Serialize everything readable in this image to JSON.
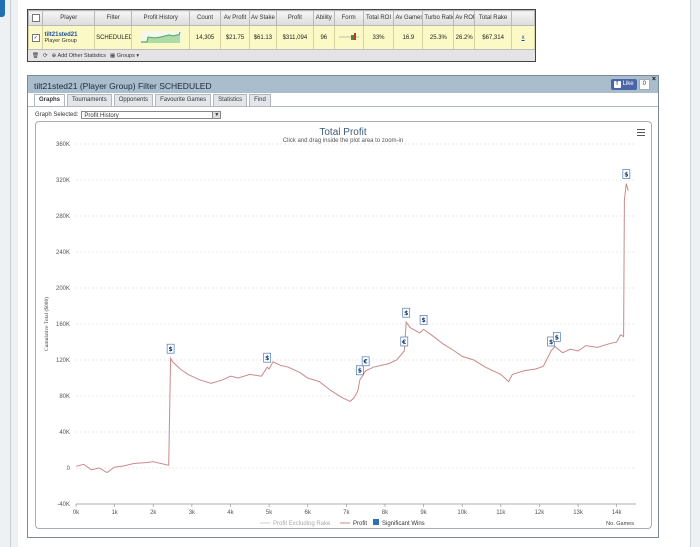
{
  "top_table": {
    "headers": [
      "",
      "Player",
      "Filter",
      "Profit History",
      "Count",
      "Av Profit",
      "Av Stake",
      "Profit",
      "Ability",
      "Form",
      "Total ROI",
      "Av Games",
      "Turbo Ratio",
      "Av ROI",
      "Total Rake",
      ""
    ],
    "row": {
      "player_name": "tilt21sted21",
      "player_sub": "Player Group",
      "filter": "SCHEDULED",
      "count": "14,305",
      "av_profit": "$21.75",
      "av_stake": "$61.13",
      "profit": "$311,094",
      "ability": "96",
      "total_roi": "33%",
      "av_games": "16.9",
      "turbo_ratio": "25.3%",
      "av_roi": "26.2%",
      "total_rake": "$67,314",
      "action": "x"
    },
    "footer": {
      "add_stats": "Add Other Statistics",
      "groups": "Groups"
    }
  },
  "panel": {
    "title": "tilt21sted21 (Player Group) Filter SCHEDULED",
    "like_label": "Like",
    "like_count": "0",
    "close": "×",
    "tabs": [
      "Graphs",
      "Tournaments",
      "Opponents",
      "Favourite Games",
      "Statistics",
      "Find"
    ],
    "graph_selected_label": "Graph Selected:",
    "graph_selected_value": "Profit History"
  },
  "colors": {
    "profit_line": "#c98a8a",
    "rake_line": "#cfcfcf",
    "significant": "#2f6fba",
    "header_bg": "#aabdcc"
  },
  "chart_data": {
    "type": "line",
    "title": "Total Profit",
    "subtitle": "Click and drag inside the plot area to zoom-in",
    "xlabel": "No. Games",
    "ylabel": "Cumulative Total ($000)",
    "xlim": [
      0,
      14500
    ],
    "ylim": [
      -40000,
      360000
    ],
    "x_ticks": [
      0,
      1000,
      2000,
      3000,
      4000,
      5000,
      6000,
      7000,
      8000,
      9000,
      10000,
      11000,
      12000,
      13000,
      14000
    ],
    "x_tick_labels": [
      "0k",
      "1k",
      "2k",
      "3k",
      "4k",
      "5k",
      "6k",
      "7k",
      "8k",
      "9k",
      "10k",
      "11k",
      "12k",
      "13k",
      "14k"
    ],
    "y_ticks": [
      -40000,
      0,
      40000,
      80000,
      120000,
      160000,
      200000,
      240000,
      280000,
      320000,
      360000
    ],
    "y_tick_labels": [
      "-40K",
      "0",
      "40K",
      "80K",
      "120K",
      "160K",
      "200K",
      "240K",
      "280K",
      "320K",
      "360K"
    ],
    "grid": true,
    "legend_position": "bottom",
    "legend": [
      "Profit Excluding Rake",
      "Profit",
      "Significant Wins"
    ],
    "series": [
      {
        "name": "Profit",
        "x": [
          0,
          200,
          400,
          600,
          800,
          1000,
          1200,
          1500,
          1800,
          2000,
          2200,
          2400,
          2450,
          2500,
          2700,
          2900,
          3200,
          3500,
          3800,
          4000,
          4200,
          4500,
          4800,
          4950,
          5000,
          5100,
          5300,
          5500,
          5800,
          6000,
          6300,
          6600,
          6900,
          7100,
          7200,
          7300,
          7350,
          7500,
          7700,
          7900,
          8100,
          8300,
          8500,
          8550,
          8650,
          8900,
          9000,
          9200,
          9500,
          9800,
          10000,
          10300,
          10600,
          11000,
          11200,
          11300,
          11600,
          11900,
          12100,
          12300,
          12400,
          12600,
          12800,
          13000,
          13200,
          13500,
          13800,
          14000,
          14100,
          14180,
          14200,
          14250,
          14300
        ],
        "y": [
          2000,
          4000,
          -2000,
          0,
          -5000,
          1000,
          2000,
          5000,
          6000,
          7000,
          5000,
          3000,
          122000,
          118000,
          110000,
          104000,
          98000,
          94000,
          98000,
          102000,
          100000,
          104000,
          102000,
          112000,
          110000,
          118000,
          114000,
          112000,
          106000,
          100000,
          96000,
          86000,
          78000,
          74000,
          78000,
          86000,
          98000,
          108000,
          112000,
          114000,
          116000,
          120000,
          130000,
          162000,
          156000,
          150000,
          154000,
          148000,
          138000,
          130000,
          124000,
          120000,
          112000,
          104000,
          96000,
          104000,
          108000,
          110000,
          113000,
          130000,
          135000,
          128000,
          132000,
          130000,
          136000,
          134000,
          138000,
          140000,
          148000,
          146000,
          298000,
          316000,
          308000
        ]
      }
    ],
    "significant_wins": [
      {
        "x": 2450,
        "y": 122000,
        "label": "$"
      },
      {
        "x": 4950,
        "y": 112000,
        "label": "$"
      },
      {
        "x": 7350,
        "y": 98000,
        "label": "$"
      },
      {
        "x": 7500,
        "y": 108000,
        "label": "€"
      },
      {
        "x": 8500,
        "y": 130000,
        "label": "€"
      },
      {
        "x": 8550,
        "y": 162000,
        "label": "$"
      },
      {
        "x": 9000,
        "y": 154000,
        "label": "$"
      },
      {
        "x": 12300,
        "y": 130000,
        "label": "$"
      },
      {
        "x": 12450,
        "y": 135000,
        "label": "$"
      },
      {
        "x": 14250,
        "y": 316000,
        "label": "$"
      }
    ]
  }
}
